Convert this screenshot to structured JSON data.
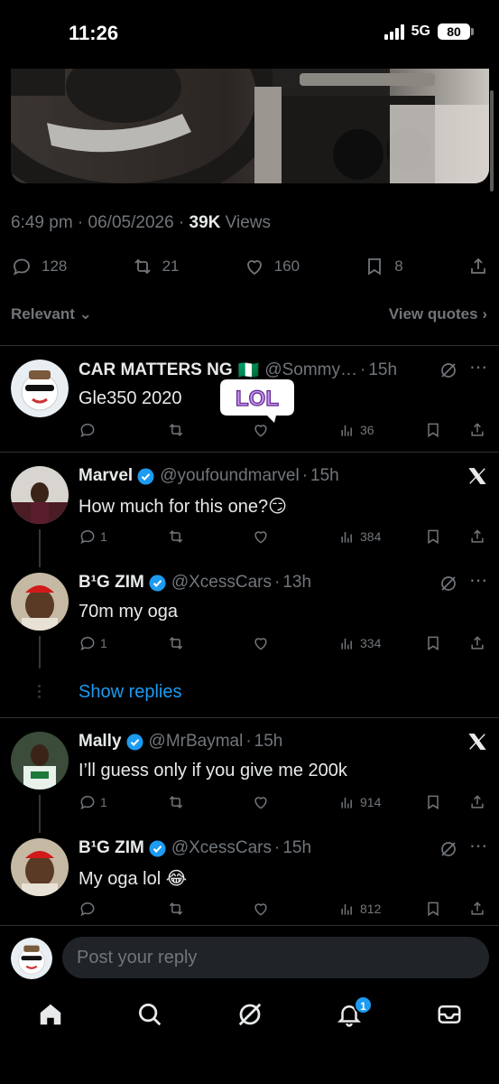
{
  "status": {
    "time": "11:26",
    "network": "5G",
    "battery": "80"
  },
  "tweet": {
    "time": "6:49 pm",
    "date": "06/05/2026",
    "views_count": "39K",
    "views_label": "Views",
    "replies": "128",
    "reposts": "21",
    "likes": "160",
    "bookmarks": "8"
  },
  "filters": {
    "sort": "Relevant",
    "quotes": "View quotes"
  },
  "sticker": {
    "text": "LOL"
  },
  "replies": [
    {
      "name": "CAR MATTERS NG",
      "flag": "🇳🇬",
      "handle": "@Sommy…",
      "sep": "·",
      "time": "15h",
      "text": "Gle350 2020",
      "reply_count": "",
      "repost_count": "",
      "like_count": "",
      "views": "36"
    },
    {
      "name": "Marvel",
      "handle": "@youfoundmarvel",
      "sep": "·",
      "time": "15h",
      "text": "How much for this one?😏",
      "reply_count": "1",
      "views": "384"
    },
    {
      "name": "B¹G ZIM",
      "handle": "@XcessCars",
      "sep": "·",
      "time": "13h",
      "text": "70m my oga",
      "reply_count": "1",
      "views": "334"
    },
    {
      "name": "Mally",
      "handle": "@MrBaymal",
      "sep": "·",
      "time": "15h",
      "text": "I’ll guess only if you give me 200k",
      "reply_count": "1",
      "views": "914"
    },
    {
      "name": "B¹G ZIM",
      "handle": "@XcessCars",
      "sep": "·",
      "time": "15h",
      "text": "My oga lol 😂",
      "reply_count": "",
      "views": "812"
    }
  ],
  "show_replies": "Show replies",
  "reply_box": {
    "placeholder": "Post your reply"
  },
  "tabbar": {
    "notifications_badge": "1"
  },
  "colors": {
    "accent": "#1d9bf0",
    "muted": "#71767b",
    "background": "#000000"
  }
}
